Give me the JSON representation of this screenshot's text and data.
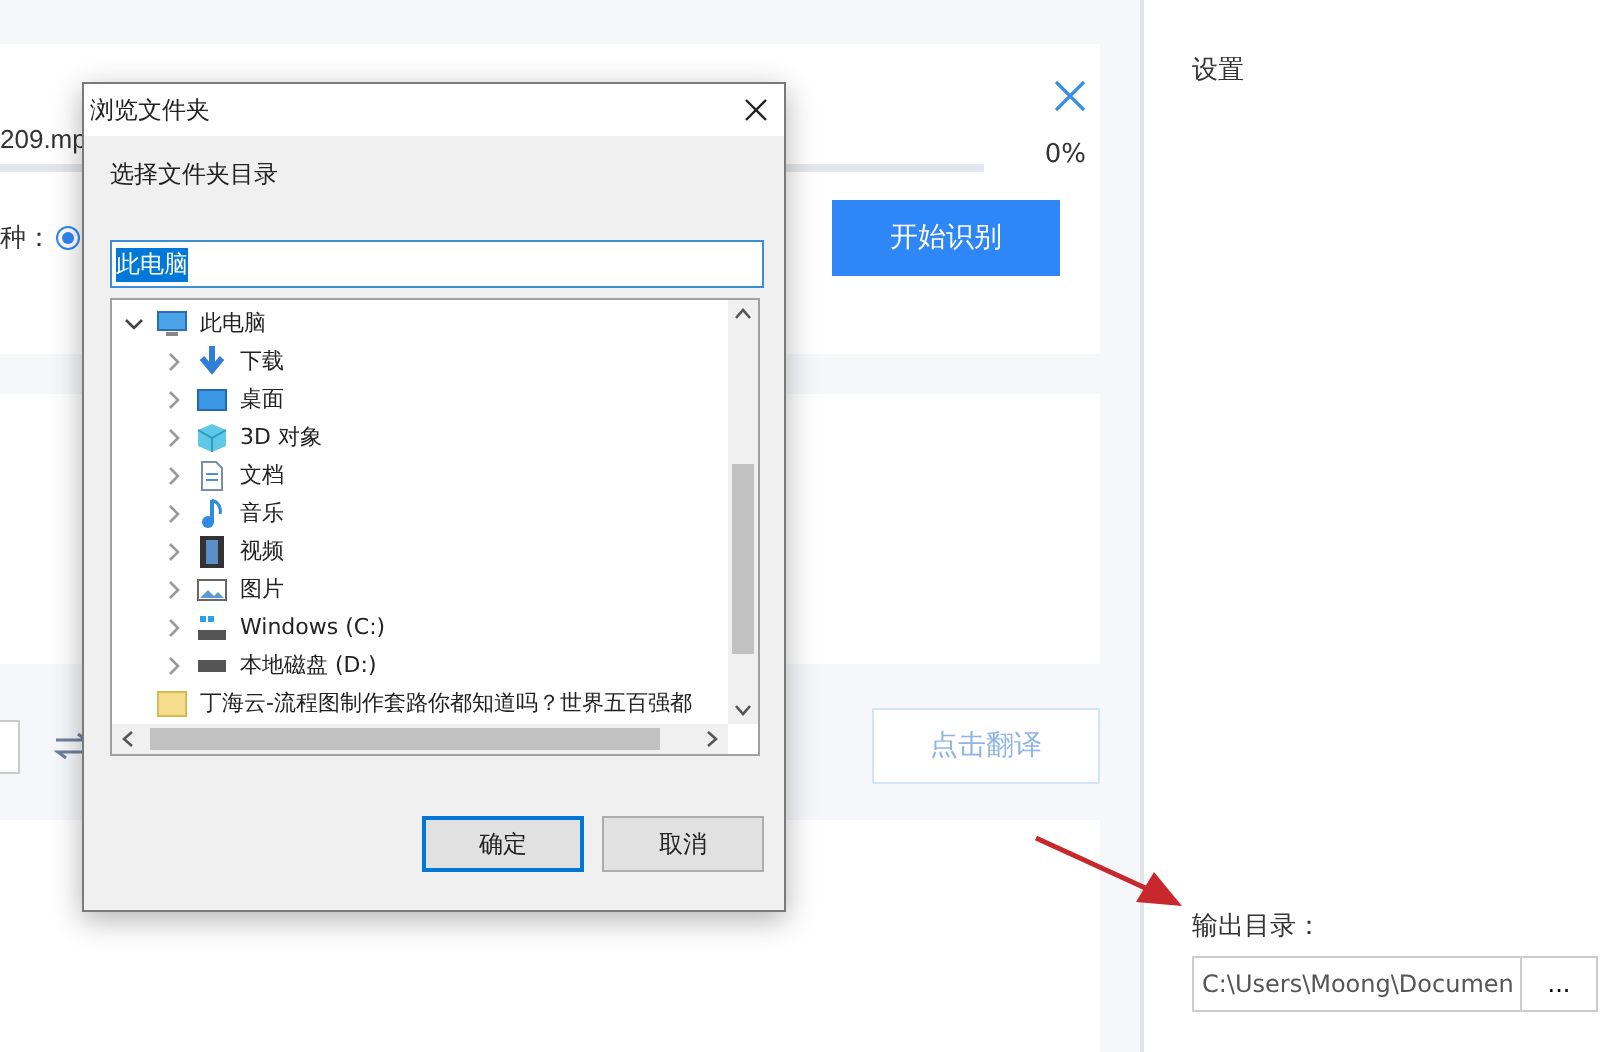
{
  "app": {
    "file_card": {
      "filename": "209.mp",
      "progress": {
        "level": 0,
        "reading": "0%"
      },
      "language_label": "种：",
      "radio": {
        "selected": true
      },
      "start_button": "开始识别"
    },
    "translate_button": {
      "label": "点击翻译",
      "disabled": true
    }
  },
  "settings": {
    "title": "设置",
    "output_label": "输出目录：",
    "output_path": "C:\\Users\\Moong\\Documen",
    "browse_button": "..."
  },
  "dialog": {
    "title": "浏览文件夹",
    "prompt": "选择文件夹目录",
    "folder_field": {
      "value": "此电脑",
      "selected": true
    },
    "tree": [
      {
        "label": "此电脑",
        "expanded": true,
        "children": [
          {
            "label": "下载",
            "expanded": false
          },
          {
            "label": "桌面",
            "expanded": false
          },
          {
            "label": "3D 对象",
            "expanded": false
          },
          {
            "label": "文档",
            "expanded": false
          },
          {
            "label": "音乐",
            "expanded": false
          },
          {
            "label": "视频",
            "expanded": false
          },
          {
            "label": "图片",
            "expanded": false
          },
          {
            "label": "Windows (C:)",
            "expanded": false
          },
          {
            "label": "本地磁盘 (D:)",
            "expanded": false
          }
        ]
      },
      {
        "label": "丁海云-流程图制作套路你都知道吗？世界五百强都"
      }
    ],
    "buttons": [
      {
        "label": "确定",
        "default": true
      },
      {
        "label": "取消",
        "default": false
      }
    ]
  }
}
